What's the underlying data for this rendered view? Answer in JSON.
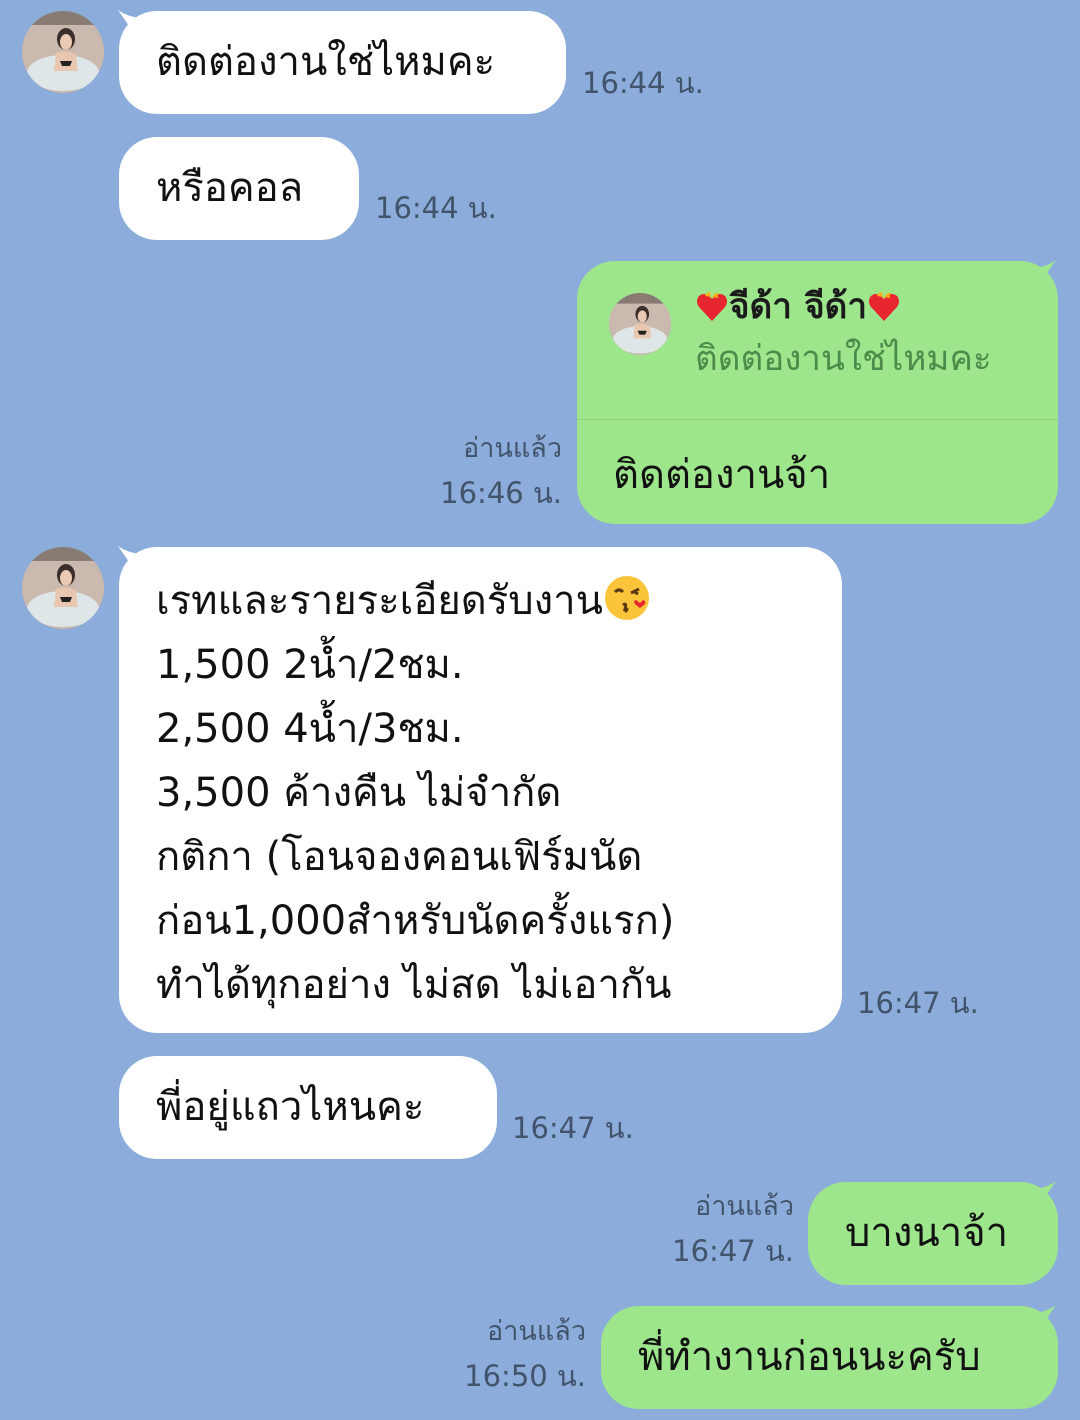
{
  "messages": {
    "m1": {
      "text": "ติดต่องานใช่ไหมคะ",
      "time": "16:44 น."
    },
    "m2": {
      "text": "หรือคอล",
      "time": "16:44 น."
    },
    "m3": {
      "reply_name": "จีด้า จีด้า",
      "reply_quote": "ติดต่องานใช่ไหมคะ",
      "text": "ติดต่องานจ้า",
      "read": "อ่านแล้ว",
      "time": "16:46 น."
    },
    "m4": {
      "lines": [
        "เรทและรายระเอียดรับงาน",
        "1,500 2น้ำ/2ชม.",
        "2,500 4น้ำ/3ชม.",
        "3,500 ค้างคืน ไม่จำกัด",
        "กติกา (โอนจองคอนเฟิร์มนัด",
        "ก่อน1,000สำหรับนัดครั้งแรก)",
        "ทำได้ทุกอย่าง ไม่สด ไม่เอากัน"
      ],
      "time": "16:47 น."
    },
    "m5": {
      "text": "พี่อยู่แถวไหนคะ",
      "time": "16:47 น."
    },
    "m6": {
      "text": "บางนาจ้า",
      "read": "อ่านแล้ว",
      "time": "16:47 น."
    },
    "m7": {
      "text": "พี่ทำงานก่อนนะครับ",
      "read": "อ่านแล้ว",
      "time": "16:50 น."
    }
  },
  "icons": {
    "reply_name_decoration": "fire-heart-icon",
    "m4_emoji": "kissing-face-with-heart-icon"
  },
  "colors": {
    "background": "#8caddb",
    "incoming_bubble": "#ffffff",
    "outgoing_bubble": "#9de68c"
  }
}
